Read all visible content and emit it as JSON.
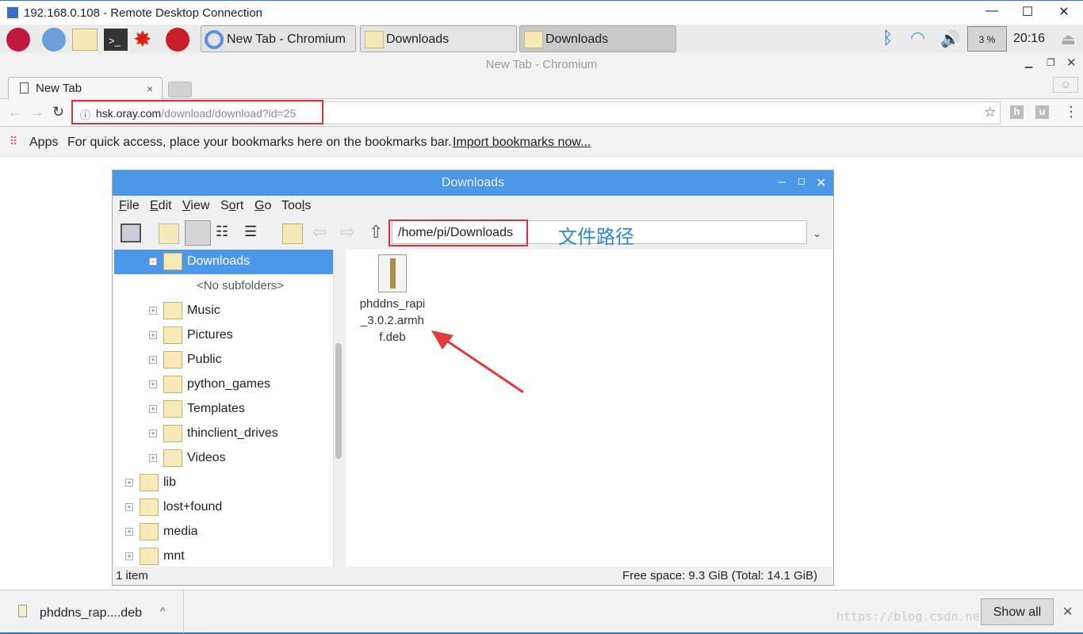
{
  "rdp": {
    "title": "192.168.0.108 - Remote Desktop Connection",
    "minimize": "—",
    "maximize": "☐",
    "close": "✕"
  },
  "taskbar": {
    "tasks": [
      "New Tab - Chromium",
      "Downloads",
      "Downloads"
    ],
    "cpu": "3 %",
    "clock": "20:16"
  },
  "chrome": {
    "window_title": "New Tab - Chromium",
    "tab": "New Tab",
    "url_host": "hsk.oray.com",
    "url_path": "/download/download?id=25",
    "apps": "Apps",
    "bookmarks_hint": "For quick access, place your bookmarks here on the bookmarks bar.",
    "import_link": "Import bookmarks now..."
  },
  "fm": {
    "title": "Downloads",
    "menu": [
      {
        "u": "F",
        "r": "ile"
      },
      {
        "u": "E",
        "r": "dit"
      },
      {
        "u": "V",
        "r": "iew"
      },
      {
        "pre": "S",
        "u": "o",
        "r": "rt"
      },
      {
        "u": "G",
        "r": "o"
      },
      {
        "pre": "Too",
        "u": "l",
        "r": "s"
      }
    ],
    "path": "/home/pi/Downloads",
    "annotation": "文件路径",
    "tree": [
      {
        "label": "Downloads",
        "level": 1,
        "exp": "−",
        "sel": true
      },
      {
        "label": "<No subfolders>",
        "level": 2,
        "none": true
      },
      {
        "label": "Music",
        "level": 1,
        "exp": "+"
      },
      {
        "label": "Pictures",
        "level": 1,
        "exp": "+"
      },
      {
        "label": "Public",
        "level": 1,
        "exp": "+"
      },
      {
        "label": "python_games",
        "level": 1,
        "exp": "+"
      },
      {
        "label": "Templates",
        "level": 1,
        "exp": "+"
      },
      {
        "label": "thinclient_drives",
        "level": 1,
        "exp": "+"
      },
      {
        "label": "Videos",
        "level": 1,
        "exp": "+"
      },
      {
        "label": "lib",
        "level": 0,
        "exp": "+"
      },
      {
        "label": "lost+found",
        "level": 0,
        "exp": "+"
      },
      {
        "label": "media",
        "level": 0,
        "exp": "+"
      },
      {
        "label": "mnt",
        "level": 0,
        "exp": "+"
      }
    ],
    "file": {
      "name_lines": [
        "phddns_rapi",
        "_3.0.2.armh",
        "f.deb"
      ]
    },
    "status_left": "1 item",
    "status_right": "Free space: 9.3 GiB (Total: 14.1 GiB)"
  },
  "download": {
    "file": "phddns_rap....deb",
    "show_all": "Show all",
    "watermark": "https://blog.csdn.net/meteor_s"
  }
}
